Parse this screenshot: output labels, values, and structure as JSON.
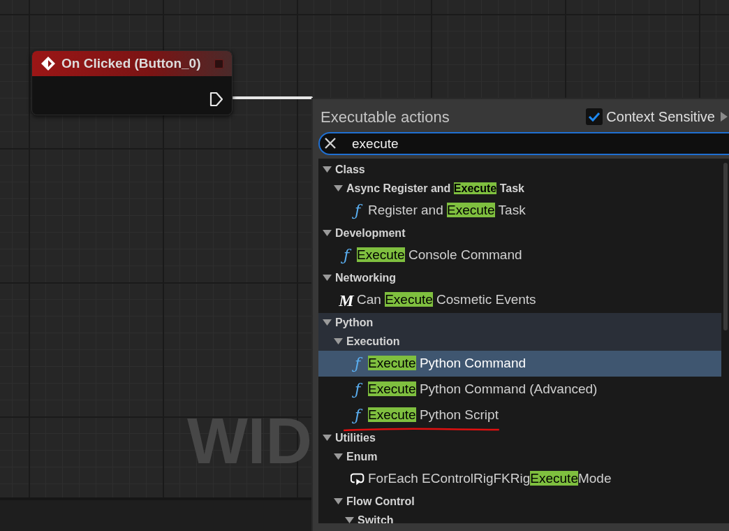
{
  "graph": {
    "corner_label": "WID"
  },
  "node": {
    "title": "On Clicked (Button_0)"
  },
  "action_menu": {
    "title": "Executable actions",
    "context_sensitive": {
      "label": "Context Sensitive",
      "checked": true
    },
    "search": {
      "value": "execute"
    },
    "tree": [
      {
        "kind": "category",
        "parts": [
          {
            "text": "Class",
            "match": false
          }
        ],
        "expanded": true,
        "hovered": false,
        "selected": false,
        "underlined": false,
        "children": [
          {
            "kind": "category",
            "parts": [
              {
                "text": "Async Register and ",
                "match": false
              },
              {
                "text": "Execute",
                "match": true
              },
              {
                "text": " Task",
                "match": false
              }
            ],
            "expanded": true,
            "hovered": false,
            "selected": false,
            "underlined": false,
            "children": [
              {
                "kind": "function",
                "icon": "ƒ",
                "parts": [
                  {
                    "text": "Register and ",
                    "match": false
                  },
                  {
                    "text": "Execute",
                    "match": true
                  },
                  {
                    "text": " Task",
                    "match": false
                  }
                ],
                "hovered": false,
                "selected": false,
                "underlined": false
              }
            ]
          }
        ]
      },
      {
        "kind": "category",
        "parts": [
          {
            "text": "Development",
            "match": false
          }
        ],
        "expanded": true,
        "hovered": false,
        "selected": false,
        "underlined": false,
        "children": [
          {
            "kind": "function",
            "icon": "ƒ",
            "parts": [
              {
                "text": "Execute",
                "match": true
              },
              {
                "text": " Console Command",
                "match": false
              }
            ],
            "hovered": false,
            "selected": false,
            "underlined": false
          }
        ]
      },
      {
        "kind": "category",
        "parts": [
          {
            "text": "Networking",
            "match": false
          }
        ],
        "expanded": true,
        "hovered": false,
        "selected": false,
        "underlined": false,
        "children": [
          {
            "kind": "macro",
            "icon": "M",
            "parts": [
              {
                "text": "Can ",
                "match": false
              },
              {
                "text": "Execute",
                "match": true
              },
              {
                "text": " Cosmetic Events",
                "match": false
              }
            ],
            "hovered": false,
            "selected": false,
            "underlined": false
          }
        ]
      },
      {
        "kind": "category",
        "parts": [
          {
            "text": "Python",
            "match": false
          }
        ],
        "expanded": true,
        "hovered": true,
        "selected": false,
        "underlined": false,
        "children": [
          {
            "kind": "category",
            "parts": [
              {
                "text": "Execution",
                "match": false
              }
            ],
            "expanded": true,
            "hovered": true,
            "selected": false,
            "underlined": false,
            "children": [
              {
                "kind": "function",
                "icon": "ƒ",
                "parts": [
                  {
                    "text": "Execute",
                    "match": true
                  },
                  {
                    "text": " Python Command",
                    "match": false
                  }
                ],
                "hovered": false,
                "selected": true,
                "underlined": false
              },
              {
                "kind": "function",
                "icon": "ƒ",
                "parts": [
                  {
                    "text": "Execute",
                    "match": true
                  },
                  {
                    "text": " Python Command (Advanced)",
                    "match": false
                  }
                ],
                "hovered": false,
                "selected": false,
                "underlined": false
              },
              {
                "kind": "function",
                "icon": "ƒ",
                "parts": [
                  {
                    "text": "Execute",
                    "match": true
                  },
                  {
                    "text": " Python Script",
                    "match": false
                  }
                ],
                "hovered": false,
                "selected": false,
                "underlined": true
              }
            ]
          }
        ]
      },
      {
        "kind": "category",
        "parts": [
          {
            "text": "Utilities",
            "match": false
          }
        ],
        "expanded": true,
        "hovered": false,
        "selected": false,
        "underlined": false,
        "children": [
          {
            "kind": "category",
            "parts": [
              {
                "text": "Enum",
                "match": false
              }
            ],
            "expanded": true,
            "hovered": false,
            "selected": false,
            "underlined": false,
            "children": [
              {
                "kind": "loop",
                "parts": [
                  {
                    "text": "ForEach EControlRigFKRig",
                    "match": false
                  },
                  {
                    "text": "Execute",
                    "match": true
                  },
                  {
                    "text": "Mode",
                    "match": false
                  }
                ],
                "hovered": false,
                "selected": false,
                "underlined": false
              }
            ]
          },
          {
            "kind": "category",
            "parts": [
              {
                "text": "Flow Control",
                "match": false
              }
            ],
            "expanded": true,
            "hovered": false,
            "selected": false,
            "underlined": false,
            "children": [
              {
                "kind": "category",
                "parts": [
                  {
                    "text": "Switch",
                    "match": false
                  }
                ],
                "expanded": true,
                "hovered": false,
                "selected": false,
                "underlined": false
              }
            ]
          }
        ]
      }
    ]
  }
}
